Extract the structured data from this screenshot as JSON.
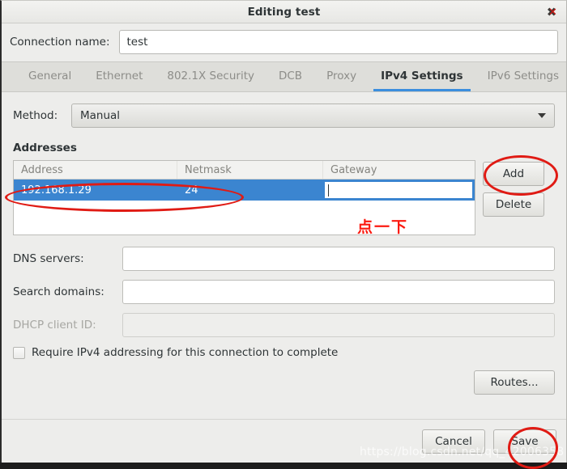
{
  "window": {
    "title": "Editing test",
    "close_icon": "close-icon"
  },
  "connection": {
    "label": "Connection name:",
    "value": "test"
  },
  "tabs": [
    {
      "label": "General",
      "active": false
    },
    {
      "label": "Ethernet",
      "active": false
    },
    {
      "label": "802.1X Security",
      "active": false
    },
    {
      "label": "DCB",
      "active": false
    },
    {
      "label": "Proxy",
      "active": false
    },
    {
      "label": "IPv4 Settings",
      "active": true
    },
    {
      "label": "IPv6 Settings",
      "active": false
    }
  ],
  "method": {
    "label": "Method:",
    "value": "Manual",
    "arrow_icon": "chevron-down-icon"
  },
  "addresses": {
    "title": "Addresses",
    "columns": [
      "Address",
      "Netmask",
      "Gateway"
    ],
    "rows": [
      {
        "address": "192.168.1.29",
        "netmask": "24",
        "gateway": ""
      }
    ],
    "add_label": "Add",
    "delete_label": "Delete"
  },
  "fields": {
    "dns_label": "DNS servers:",
    "dns_value": "",
    "search_label": "Search domains:",
    "search_value": "",
    "dhcp_label": "DHCP client ID:",
    "dhcp_value": ""
  },
  "require_checkbox": {
    "label": "Require IPv4 addressing for this connection to complete",
    "checked": false
  },
  "routes": {
    "label": "Routes..."
  },
  "actions": {
    "cancel_label": "Cancel",
    "save_label": "Save"
  },
  "annotations": {
    "note_text": "点一下",
    "color": "#e01b14"
  },
  "watermark": {
    "text": "https://blog.csdn.net/qq_42006358"
  }
}
